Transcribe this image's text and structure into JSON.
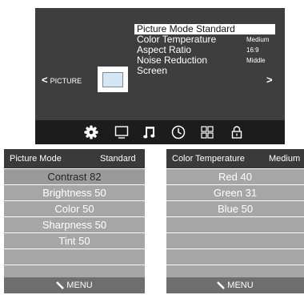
{
  "osd": {
    "menu_items": [
      {
        "label": "Picture Mode Standard",
        "value": "",
        "selected": true
      },
      {
        "label": "Color Temperature",
        "value": "Medium",
        "selected": false
      },
      {
        "label": "Aspect Ratio",
        "value": "16:9",
        "selected": false
      },
      {
        "label": "Noise Reduction",
        "value": "Middle",
        "selected": false
      },
      {
        "label": "Screen",
        "value": "",
        "selected": false
      }
    ],
    "nav_left_arrow": "<",
    "nav_left_label": "PICTURE",
    "nav_right_arrow": ">",
    "tab_icons": [
      "gear-icon",
      "monitor-icon",
      "music-note-icon",
      "clock-icon",
      "grid-icon",
      "lock-icon"
    ],
    "active_tab_icon": "gear-icon"
  },
  "picture_mode_menu": {
    "title": "Picture Mode",
    "value": "Standard",
    "rows": [
      "Contrast 82",
      "Brightness 50",
      "Color 50",
      "Sharpness 50",
      "Tint 50",
      "",
      ""
    ],
    "footer": "MENU"
  },
  "color_temperature_menu": {
    "title": "Color Temperature",
    "value": "Medium",
    "rows": [
      "Red 40",
      "Green 31",
      "Blue 50",
      "",
      "",
      "",
      ""
    ],
    "footer": "MENU"
  },
  "colors": {
    "osd_background": "#3e3e3e",
    "icon_bar": "#1c1c1c",
    "menu_header": "#3a3a3a",
    "menu_row": "#a6a6a6",
    "menu_footer": "#6e6e6e"
  }
}
